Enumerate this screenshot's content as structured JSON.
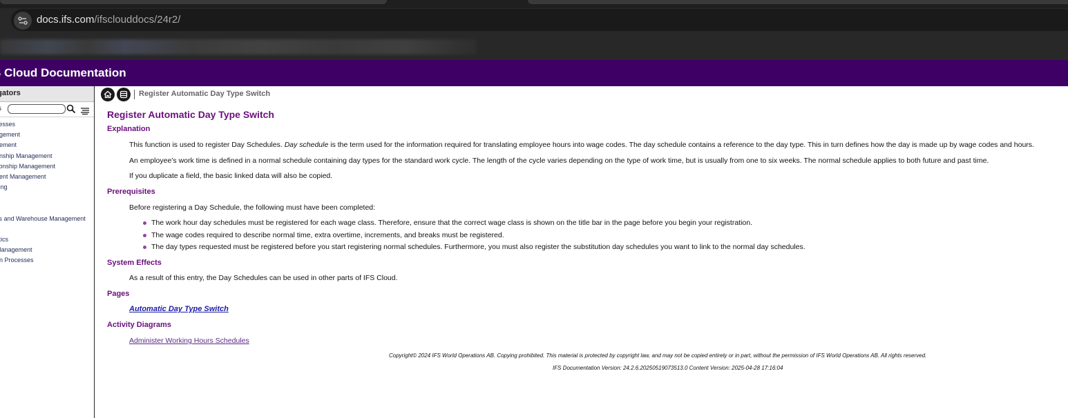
{
  "browser": {
    "url_host": "docs.ifs.com",
    "url_path": "/ifsclouddocs/24r2/"
  },
  "header": {
    "title": "S Cloud Documentation"
  },
  "navigator": {
    "title": "vigators",
    "search_label": "s",
    "items": [
      "cesses",
      "agement",
      "gement",
      "onship Management",
      "tionship Management",
      "nent Management",
      "sing",
      "",
      "cs and Warehouse Management",
      "",
      "stics",
      "Management",
      "on Processes"
    ]
  },
  "breadcrumb": {
    "current": "Register Automatic Day Type Switch"
  },
  "page": {
    "title": "Register Automatic Day Type Switch",
    "explanation": {
      "heading": "Explanation",
      "p1_before": "This function is used to register Day Schedules. ",
      "p1_italic": "Day schedule",
      "p1_after": " is the term used for the information required for translating employee hours into wage codes. The day schedule contains a reference to the day type. This in turn defines how the day is made up by wage codes and hours.",
      "p2": "An employee’s work time is defined in a normal schedule containing day types for the standard work cycle. The length of the cycle varies depending on the type of work time, but is usually from one to six weeks. The normal schedule applies to both future and past time.",
      "p3": "If you duplicate a field, the basic linked data will also be copied."
    },
    "prerequisites": {
      "heading": "Prerequisites",
      "intro": "Before registering a Day Schedule, the following must have been completed:",
      "items": [
        "The work hour day schedules must be registered for each wage class. Therefore, ensure that the correct wage class is shown on the title bar in the page before you begin your registration.",
        "The wage codes required to describe normal time, extra overtime, increments, and breaks must be registered.",
        "The day types requested must be registered before you start registering normal schedules. Furthermore, you must also register the substitution day schedules you want to link to the normal day schedules."
      ]
    },
    "system_effects": {
      "heading": "System Effects",
      "text": "As a result of this entry, the Day Schedules can be used in other parts of IFS Cloud."
    },
    "pages": {
      "heading": "Pages",
      "link": "Automatic Day Type Switch"
    },
    "activity": {
      "heading": "Activity Diagrams",
      "link": "Administer Working Hours Schedules"
    },
    "footer": {
      "copyright": "Copyright© 2024 IFS World Operations AB. Copying prohibited. This material is protected by copyright law, and may not be copied entirely or in part, without the permission of IFS World Operations AB. All rights reserved.",
      "version": "IFS Documentation Version: 24.2.6.20250519073513.0 Content Version: 2025-04-28 17:16:04"
    }
  },
  "colors": {
    "header_bg": "#3e0064",
    "heading": "#6b0e7d",
    "link_primary": "#1a1aa6",
    "link_visited": "#5b2a84"
  }
}
